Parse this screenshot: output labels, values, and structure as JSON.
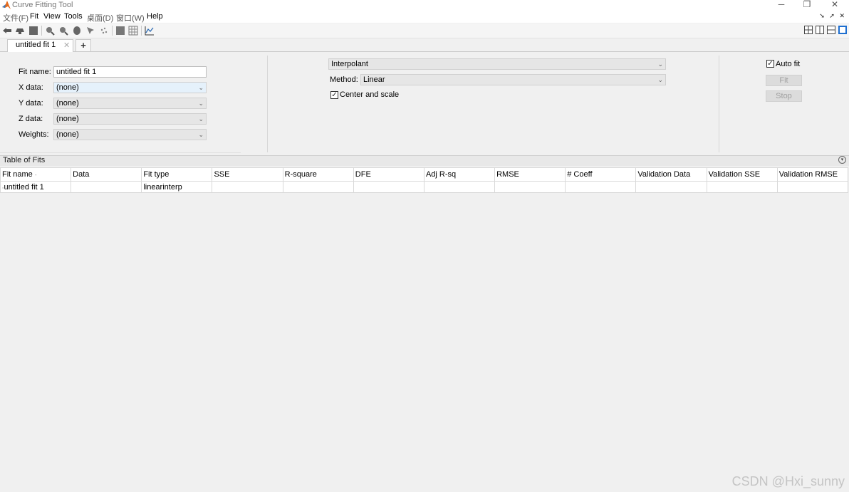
{
  "window": {
    "title": "Curve Fitting Tool",
    "controls": [
      "─",
      "❐",
      "✕"
    ]
  },
  "menu": [
    "文件(F)",
    "Fit",
    "View",
    "Tools",
    "桌面(D)",
    "窗口(W)",
    "Help"
  ],
  "dock_controls": "➘ ➚ ✕",
  "toolbar": {
    "icons": [
      "pan-left-icon",
      "pan-right-icon",
      "data-cursor-icon",
      "zoom-in-icon",
      "zoom-out-icon",
      "pan-icon",
      "data-cursor-icon-2",
      "exclude-outliers-icon",
      "legend-icon",
      "grid-icon",
      "residuals-plot-icon"
    ],
    "layout_icons": [
      "grid-layout-icon",
      "vertical-split-icon",
      "horizontal-split-icon",
      "single-layout-icon"
    ]
  },
  "tabs": {
    "active": "untitled fit 1",
    "close": "✕",
    "add": "+"
  },
  "fit_config": {
    "fit_name_label": "Fit name:",
    "fit_name_value": "untitled fit 1",
    "x_label": "X data:",
    "x_value": "(none)",
    "y_label": "Y data:",
    "y_value": "(none)",
    "z_label": "Z data:",
    "z_value": "(none)",
    "weights_label": "Weights:",
    "weights_value": "(none)"
  },
  "fit_options": {
    "fit_type": "Interpolant",
    "method_label": "Method:",
    "method_value": "Linear",
    "center_scale_label": "Center and scale",
    "center_scale_checked": true
  },
  "fit_actions": {
    "auto_fit_label": "Auto fit",
    "auto_fit_checked": true,
    "fit_button": "Fit",
    "stop_button": "Stop"
  },
  "table_of_fits": {
    "title": "Table of Fits",
    "columns": [
      "Fit name",
      "Data",
      "Fit type",
      "SSE",
      "R-square",
      "DFE",
      "Adj R-sq",
      "RMSE",
      "# Coeff",
      "Validation Data",
      "Validation SSE",
      "Validation RMSE"
    ],
    "rows": [
      [
        "untitled fit 1",
        "",
        "linearinterp",
        "",
        "",
        "",
        "",
        "",
        "",
        "",
        "",
        ""
      ]
    ]
  },
  "watermark": "CSDN @Hxi_sunny",
  "colors": {
    "background": "#f0f0f0",
    "combo_bg": "#e6e6e6",
    "combo_focus": "#e5f1fb",
    "disabled_text": "#a0a0a0"
  }
}
